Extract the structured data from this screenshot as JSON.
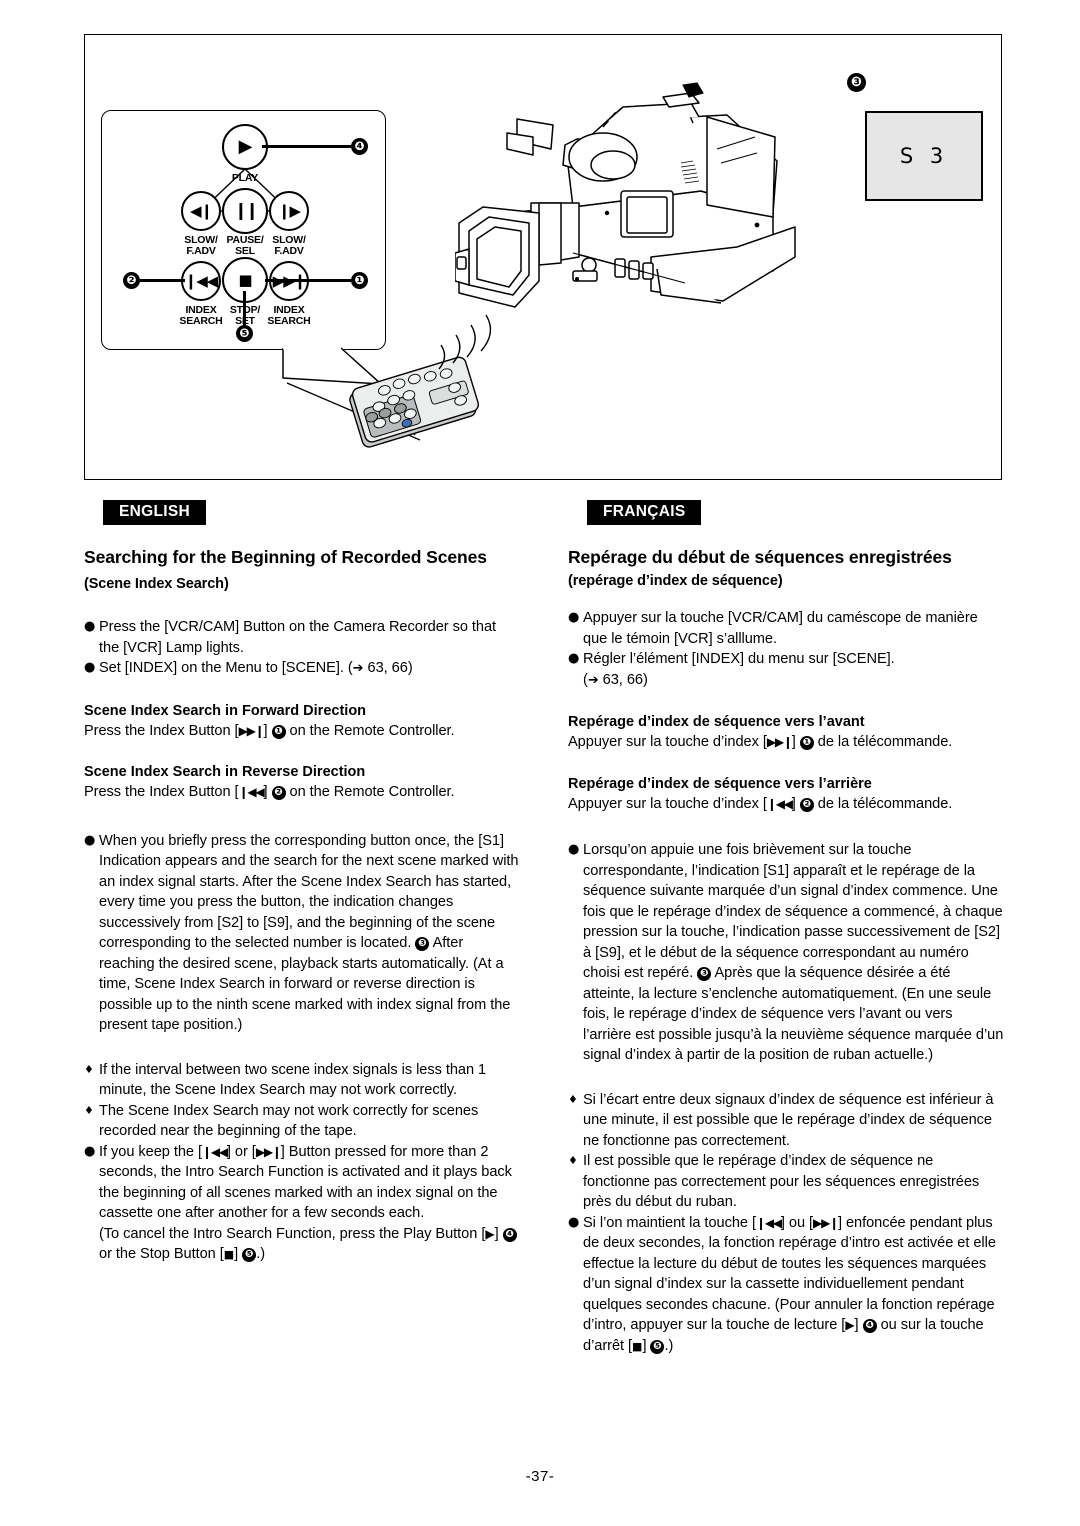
{
  "figure": {
    "remote_callout": {
      "buttons": [
        {
          "id": "play",
          "glyph": "▶",
          "label": "PLAY"
        },
        {
          "id": "slow-rev",
          "glyph": "◀❙",
          "label": "SLOW/\nF.ADV"
        },
        {
          "id": "pause-sel",
          "glyph": "❙❙",
          "label": "PAUSE/\nSEL"
        },
        {
          "id": "slow-fwd",
          "glyph": "❙▶",
          "label": "SLOW/\nF.ADV"
        },
        {
          "id": "index-rev",
          "glyph": "❙◀◀",
          "label": "INDEX\nSEARCH"
        },
        {
          "id": "stop-set",
          "glyph": "■",
          "label": "STOP/\nSET"
        },
        {
          "id": "index-fwd",
          "glyph": "▶▶❙",
          "label": "INDEX\nSEARCH"
        }
      ],
      "callout_numbers": {
        "index_fwd": "❶",
        "index_rev": "❷",
        "play": "❹",
        "stop": "❺"
      }
    },
    "lcd": {
      "badge": "❸",
      "indication": "S 3"
    }
  },
  "english": {
    "lang_label": "ENGLISH",
    "title_main": "Searching for the Beginning of Recorded Scenes",
    "title_sub": "(Scene Index Search)",
    "intro_bullets": [
      "Press the [VCR/CAM] Button on the Camera Recorder so that the [VCR] Lamp lights.",
      "Set [INDEX] on the Menu to [SCENE]."
    ],
    "intro_page_ref": "63, 66",
    "forward": {
      "heading": "Scene Index Search in Forward Direction",
      "body_pre": "Press the Index Button [",
      "body_mid": "] ",
      "body_post": " on the Remote Controller."
    },
    "reverse": {
      "heading": "Scene Index Search in Reverse Direction",
      "body_pre": "Press the Index Button [",
      "body_mid": "] ",
      "body_post": " on the Remote Controller."
    },
    "note_main_a": "When you briefly press the corresponding button once, the [S1] Indication appears and the search for the next scene marked with an index signal starts. After the Scene Index Search has started, every time you press the button, the indication changes successively from [S2] to [S9], and the beginning of the scene corresponding to the selected number is located.",
    "note_main_b": "After reaching the desired scene, playback starts automatically. (At a time, Scene Index Search in forward or reverse direction is possible up to the ninth scene marked with index signal from the present tape position.)",
    "caveats": [
      "If the interval between two scene index signals is less than 1 minute, the Scene Index Search may not work correctly.",
      "The Scene Index Search may not work correctly for scenes recorded near the beginning of the tape."
    ],
    "intro_search": {
      "a": "If you keep the [",
      "b": "] or [",
      "c": "] Button pressed for more than 2 seconds, the Intro Search Function is activated and it plays back the beginning of all scenes marked with an index signal on the cassette one after another for a few seconds each.",
      "d": "(To cancel the Intro Search Function, press the Play Button [",
      "e": "] ",
      "f": " or the Stop Button [",
      "g": "] ",
      "h": ".)"
    }
  },
  "francais": {
    "lang_label": "FRANÇAIS",
    "title_main": "Repérage du début de séquences enregistrées",
    "title_sub": "(repérage d’index de séquence)",
    "intro_bullets": [
      "Appuyer sur la touche [VCR/CAM] du caméscope de manière que le témoin [VCR] s’alllume.",
      "Régler l’élément [INDEX] du menu sur [SCENE]."
    ],
    "intro_page_ref": "63, 66",
    "forward": {
      "heading": "Repérage d’index de séquence vers l’avant",
      "body_pre": "Appuyer sur la touche d’index [",
      "body_mid": "] ",
      "body_post": " de la télécommande."
    },
    "reverse": {
      "heading": "Repérage d’index de séquence vers l’arrière",
      "body_pre": "Appuyer sur la touche d’index [",
      "body_mid": "] ",
      "body_post": " de la télécommande."
    },
    "note_main_a": "Lorsqu’on appuie une fois brièvement sur la touche correspondante, l’indication [S1] apparaît et le repérage de la séquence suivante marquée d’un signal d’index commence. Une fois que le repérage d’index de séquence a commencé, à chaque pression sur la touche, l’indication passe successivement de [S2] à [S9], et le début de la séquence correspondant au numéro choisi est repéré.",
    "note_main_b": "Après que la séquence désirée a été atteinte, la lecture s’enclenche automatiquement. (En une seule fois, le repérage d’index de séquence vers l’avant ou vers l’arrière est possible jusqu’à la neuvième séquence marquée d’un signal d’index à partir de la position de ruban actuelle.)",
    "caveats": [
      "Si l’écart entre deux signaux d’index de séquence est inférieur à une minute, il est possible que le repérage d’index de séquence ne fonctionne pas correctement.",
      "Il est possible que le repérage d’index de séquence ne fonctionne pas correctement pour les séquences enregistrées près du début du ruban."
    ],
    "intro_search": {
      "a": "Si l’on maintient la touche [",
      "b": "] ou [",
      "c": "] enfoncée pendant plus de deux secondes, la fonction repérage d’intro est activée et elle effectue la lecture du début de toutes les séquences marquées d’un signal d’index sur la cassette individuellement pendant quelques secondes chacune. (Pour annuler la fonction repérage d’intro, appuyer sur la touche de lecture [",
      "e": "] ",
      "f": " ou sur la touche d’arrêt [",
      "g": "] ",
      "h": ".)"
    }
  },
  "glyphs": {
    "bullet_dot": "●",
    "bullet_diamond": "♦",
    "arrow_right": "➔",
    "index_fwd_sym": "▶▶❙",
    "index_rev_sym": "❙◀◀",
    "play_sym": "▶",
    "stop_sym": "■",
    "n1": "❶",
    "n2": "❷",
    "n3": "❸",
    "n4": "❹",
    "n5": "❺"
  },
  "footer": {
    "page_number": "-37-"
  }
}
